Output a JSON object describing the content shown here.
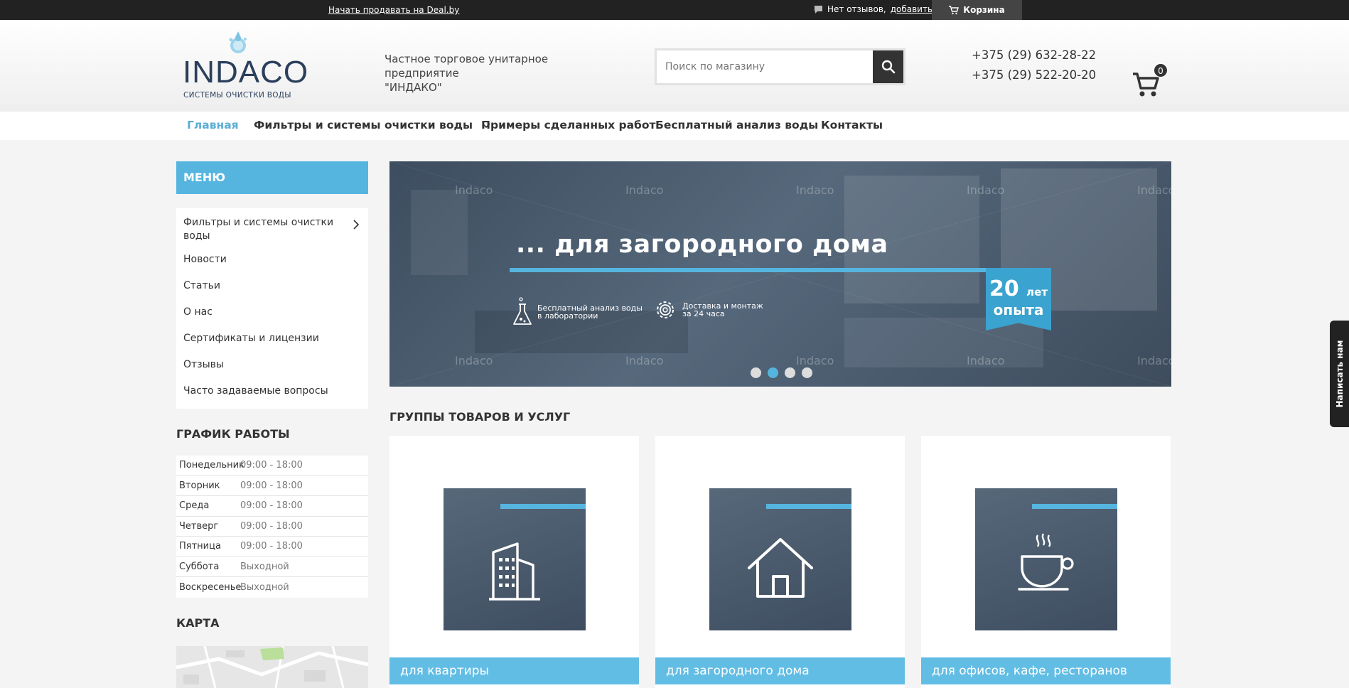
{
  "topbar": {
    "sell_link": "Начать продавать на Deal.by",
    "reviews_text": "Нет отзывов,",
    "reviews_add": "добавить",
    "cart_label": "Корзина"
  },
  "header": {
    "logo_text": "INDACO",
    "logo_sub": "СИСТЕМЫ ОЧИСТКИ ВОДЫ",
    "company_line1": "Частное торговое унитарное предприятие",
    "company_line2": "\"ИНДАКО\"",
    "search_placeholder": "Поиск по магазину",
    "phone1": "+375 (29) 632-28-22",
    "phone2": "+375 (29) 522-20-20",
    "cart_count": "0"
  },
  "nav": {
    "home": "Главная",
    "filters": "Фильтры и системы очистки воды",
    "examples": "Примеры сделанных работ",
    "analysis": "Бесплатный анализ воды",
    "contacts": "Контакты"
  },
  "sidebar": {
    "menu_title": "МЕНЮ",
    "items": [
      "Фильтры и системы очистки воды",
      "Новости",
      "Статьи",
      "О нас",
      "Сертификаты и лицензии",
      "Отзывы",
      "Часто задаваемые вопросы"
    ],
    "schedule_title": "ГРАФИК РАБОТЫ",
    "schedule": [
      {
        "day": "Понедельник",
        "time": "09:00 - 18:00"
      },
      {
        "day": "Вторник",
        "time": "09:00 - 18:00"
      },
      {
        "day": "Среда",
        "time": "09:00 - 18:00"
      },
      {
        "day": "Четверг",
        "time": "09:00 - 18:00"
      },
      {
        "day": "Пятница",
        "time": "09:00 - 18:00"
      },
      {
        "day": "Суббота",
        "time": "Выходной"
      },
      {
        "day": "Воскресенье",
        "time": "Выходной"
      }
    ],
    "map_title": "КАРТА"
  },
  "banner": {
    "title": "... для загородного дома",
    "feature1_line1": "Бесплатный анализ воды",
    "feature1_line2": "в лаборатории",
    "feature2_line1": "Доставка и монтаж",
    "feature2_line2": "за 24 часа",
    "badge_number": "20",
    "badge_unit": "лет",
    "badge_text": "опыта",
    "watermark": "Indaco",
    "active_slide": 2,
    "slide_count": 4
  },
  "groups": {
    "title": "ГРУППЫ ТОВАРОВ И УСЛУГ",
    "cards": [
      {
        "label": "для квартиры",
        "icon": "building-icon"
      },
      {
        "label": "для загородного дома",
        "icon": "house-icon"
      },
      {
        "label": "для офисов, кафе, ресторанов",
        "icon": "coffee-cup-icon"
      }
    ]
  },
  "widget": {
    "write_us": "Написать нам"
  },
  "colors": {
    "accent": "#55b5df",
    "topbar": "#222222",
    "card_label": "#62bde4"
  }
}
